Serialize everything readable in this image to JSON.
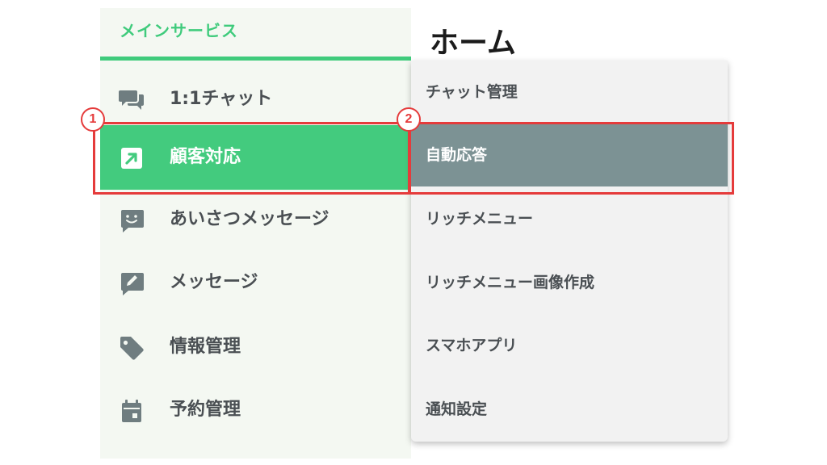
{
  "sidebar": {
    "title": "メインサービス",
    "items": [
      {
        "label": "1:1チャット",
        "icon": "chat-bubbles-icon"
      },
      {
        "label": "顧客対応",
        "icon": "arrow-up-right-icon",
        "active": true
      },
      {
        "label": "あいさつメッセージ",
        "icon": "smiley-message-icon"
      },
      {
        "label": "メッセージ",
        "icon": "edit-message-icon"
      },
      {
        "label": "情報管理",
        "icon": "tag-icon"
      },
      {
        "label": "予約管理",
        "icon": "calendar-icon"
      }
    ]
  },
  "header": {
    "title": "ホーム"
  },
  "submenu": {
    "items": [
      {
        "label": "チャット管理"
      },
      {
        "label": "自動応答",
        "active": true
      },
      {
        "label": "リッチメニュー"
      },
      {
        "label": "リッチメニュー画像作成"
      },
      {
        "label": "スマホアプリ"
      },
      {
        "label": "通知設定"
      }
    ]
  },
  "annotations": {
    "badge1": "1",
    "badge2": "2"
  },
  "colors": {
    "accent": "#43cb7e",
    "submenu_active": "#7c9294",
    "highlight": "#e53b3b",
    "icon": "#6f7d80"
  }
}
